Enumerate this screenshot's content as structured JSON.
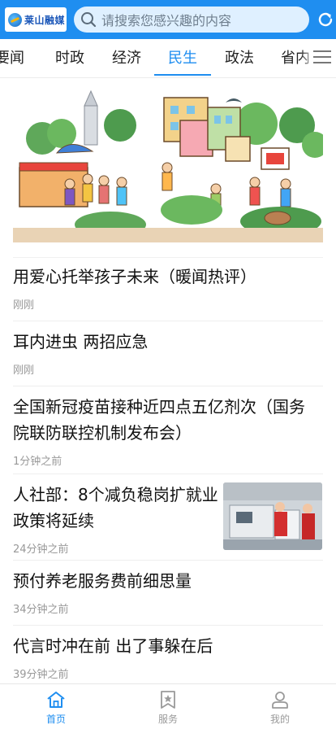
{
  "header": {
    "logo_text": "莱山融媒",
    "search_placeholder": "请搜索您感兴趣的内容"
  },
  "tabs": [
    {
      "label": "要闻"
    },
    {
      "label": "时政"
    },
    {
      "label": "经济"
    },
    {
      "label": "民生",
      "active": true
    },
    {
      "label": "政法"
    },
    {
      "label": "省内"
    }
  ],
  "news": [
    {
      "title": "用爱心托举孩子未来（暖闻热评）",
      "time": "刚刚"
    },
    {
      "title": "耳内进虫 两招应急",
      "time": "刚刚"
    },
    {
      "title": "全国新冠疫苗接种近四点五亿剂次（国务院联防联控机制发布会）",
      "time": "1分钟之前"
    },
    {
      "title": "人社部：8个减负稳岗扩就业政策将延续",
      "time": "24分钟之前"
    },
    {
      "title": "预付养老服务费前细思量",
      "time": "34分钟之前"
    },
    {
      "title": "代言时冲在前 出了事躲在后",
      "time": "39分钟之前"
    }
  ],
  "bottom_nav": [
    {
      "label": "首页",
      "icon": "home-icon",
      "active": true
    },
    {
      "label": "服务",
      "icon": "bookmark-star-icon"
    },
    {
      "label": "我的",
      "icon": "user-icon"
    }
  ],
  "colors": {
    "accent": "#1f8ef0",
    "text": "#111111",
    "muted": "#999999"
  }
}
